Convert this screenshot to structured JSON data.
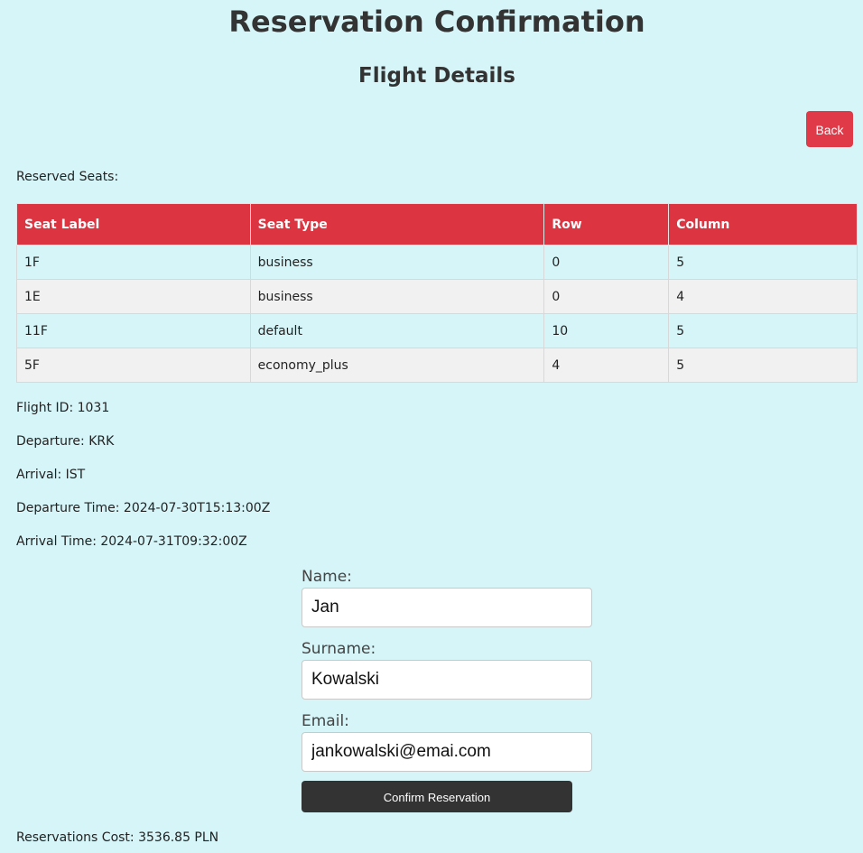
{
  "header": {
    "title": "Reservation Confirmation",
    "subtitle": "Flight Details"
  },
  "actions": {
    "back_label": "Back",
    "confirm_label": "Confirm Reservation"
  },
  "colors": {
    "background": "#d6f5f8",
    "accent_red": "#dc3441",
    "confirm_dark": "#333333"
  },
  "seats": {
    "label": "Reserved Seats:",
    "headers": [
      "Seat Label",
      "Seat Type",
      "Row",
      "Column"
    ],
    "rows": [
      [
        "1F",
        "business",
        "0",
        "5"
      ],
      [
        "1E",
        "business",
        "0",
        "4"
      ],
      [
        "11F",
        "default",
        "10",
        "5"
      ],
      [
        "5F",
        "economy_plus",
        "4",
        "5"
      ]
    ]
  },
  "flight": {
    "id_line": "Flight ID: 1031",
    "departure_line": "Departure: KRK",
    "arrival_line": "Arrival: IST",
    "departure_time_line": "Departure Time: 2024-07-30T15:13:00Z",
    "arrival_time_line": "Arrival Time: 2024-07-31T09:32:00Z"
  },
  "form": {
    "name_label": "Name:",
    "name_value": "Jan",
    "surname_label": "Surname:",
    "surname_value": "Kowalski",
    "email_label": "Email:",
    "email_value": "jankowalski@emai.com"
  },
  "cost_line": "Reservations Cost: 3536.85 PLN"
}
